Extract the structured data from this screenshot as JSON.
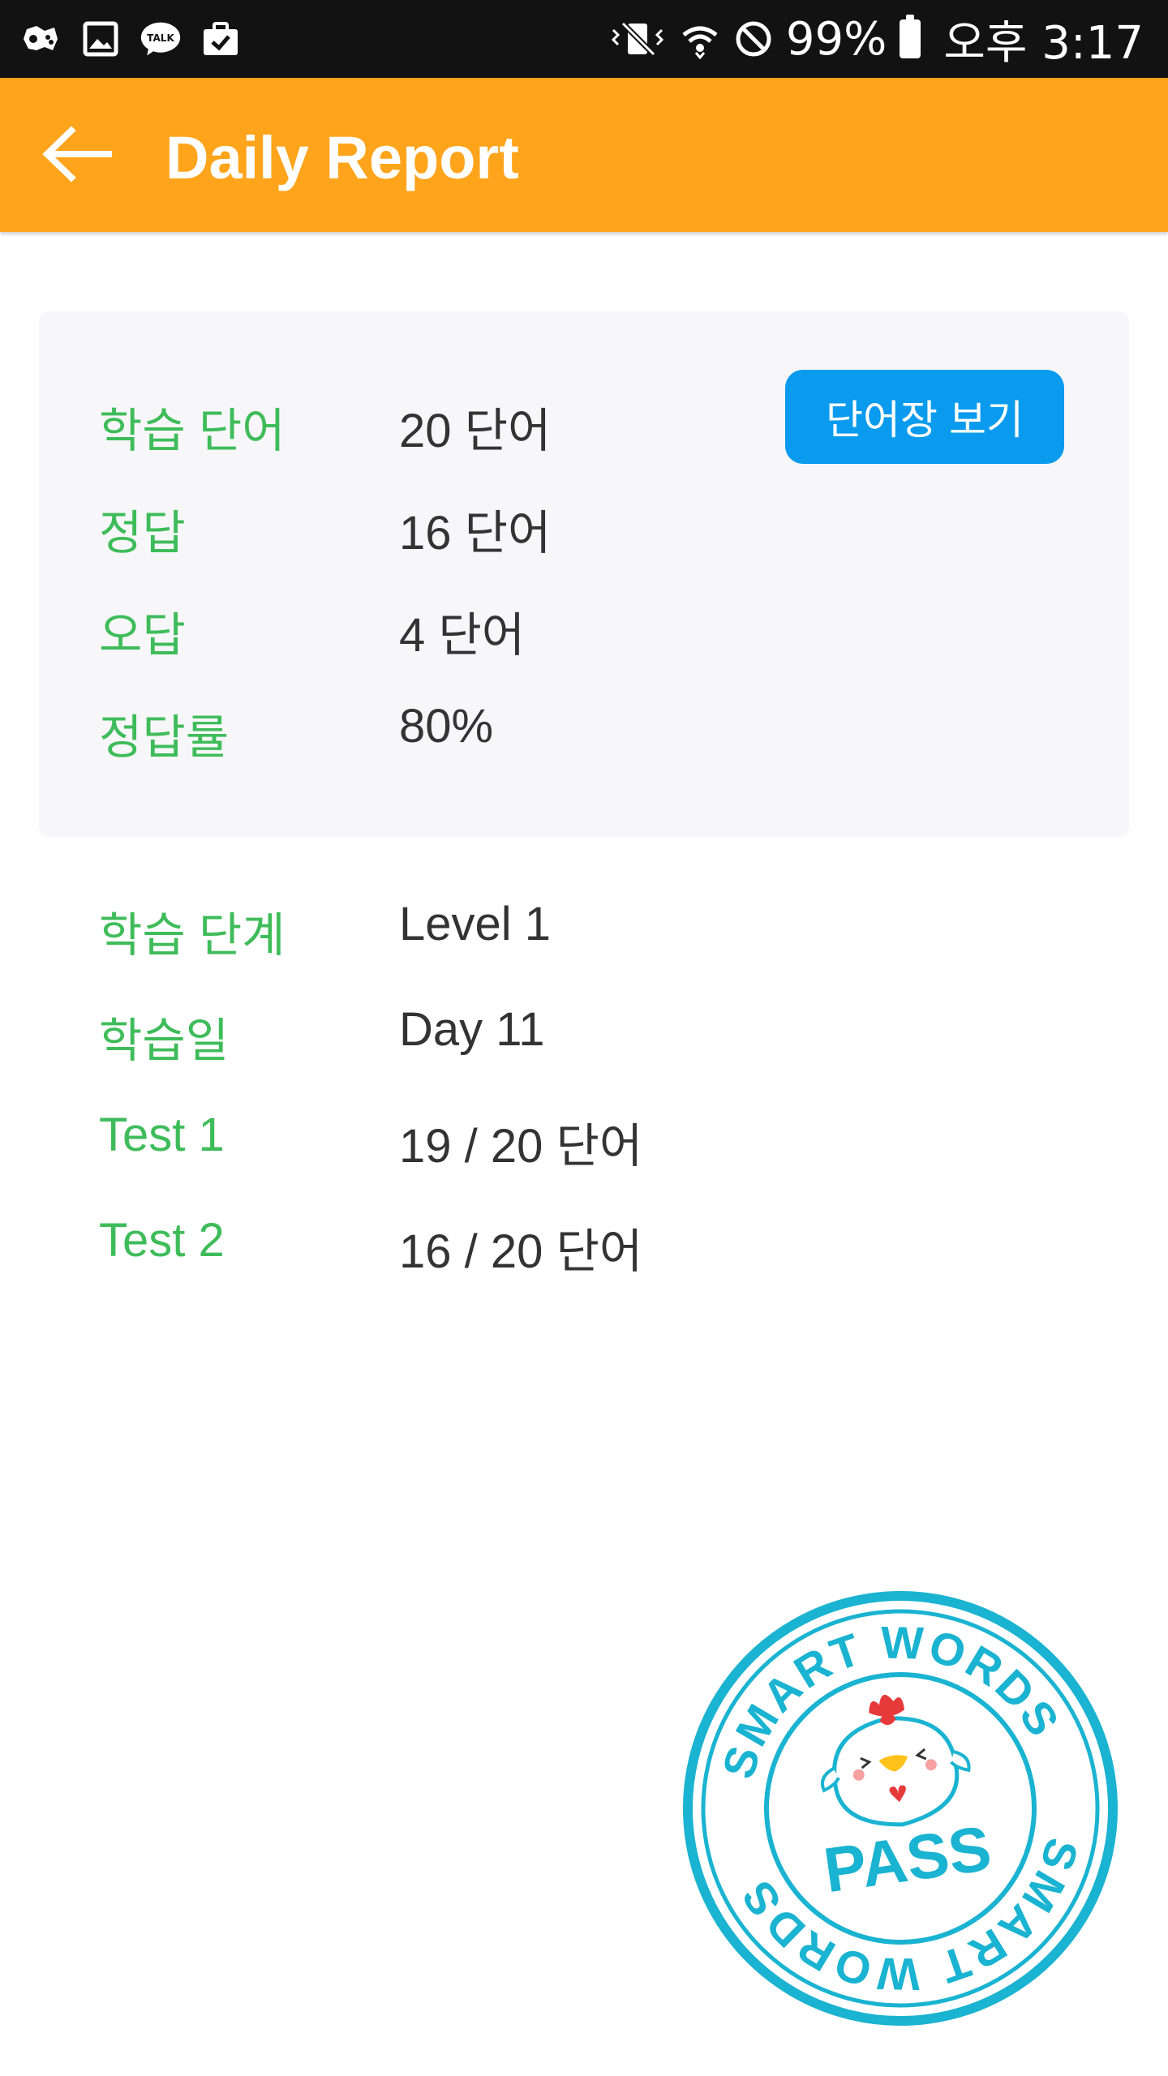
{
  "status_bar": {
    "battery_percent": "99%",
    "time": "오후 3:17",
    "left_icons": [
      "game-controller-icon",
      "image-icon",
      "kakaotalk-icon",
      "briefcase-icon"
    ],
    "kakao_label": "TALK",
    "right_icons": [
      "mute-vibrate-icon",
      "wifi-icon",
      "do-not-disturb-icon",
      "battery-icon"
    ]
  },
  "app_bar": {
    "title": "Daily Report",
    "back_icon": "arrow-left-icon",
    "color": "#FFA41B"
  },
  "summary": {
    "button_label": "단어장 보기",
    "rows": [
      {
        "label": "학습 단어",
        "value": "20 단어"
      },
      {
        "label": "정답",
        "value": "16 단어"
      },
      {
        "label": "오답",
        "value": "4 단어"
      },
      {
        "label": "정답률",
        "value": "80%"
      }
    ]
  },
  "details": {
    "rows": [
      {
        "label": "학습 단계",
        "value": "Level 1"
      },
      {
        "label": "학습일",
        "value": "Day 11"
      },
      {
        "label": "Test 1",
        "value": "19 / 20 단어"
      },
      {
        "label": "Test 2",
        "value": "16 / 20 단어"
      }
    ]
  },
  "stamp": {
    "top_text": "SMART WORDS",
    "bottom_text": "SMART WORDS",
    "center_text": "PASS",
    "color": "#1AB3D1"
  },
  "colors": {
    "label_green": "#3FBC5A",
    "button_blue": "#0A9BEE",
    "value_text": "#333333"
  }
}
